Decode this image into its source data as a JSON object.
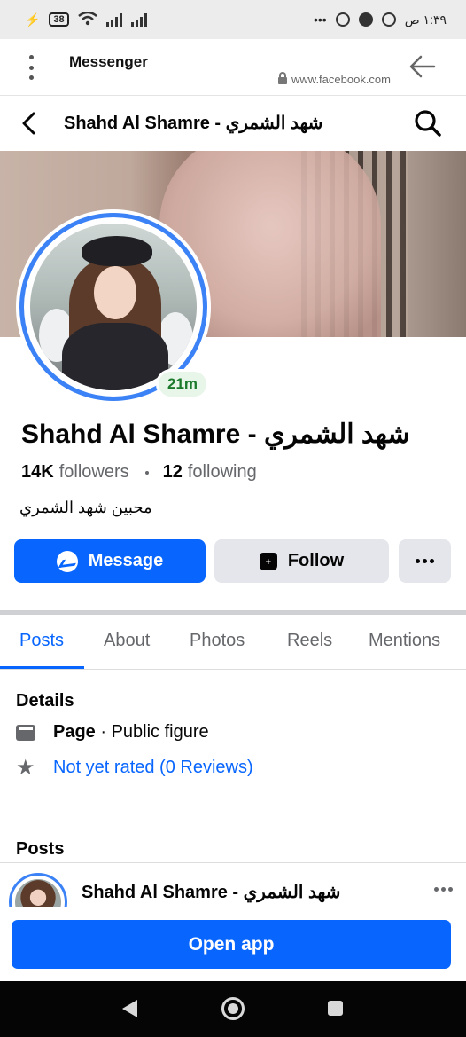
{
  "status_bar": {
    "battery": "38",
    "more": "•••",
    "time": "١:٣٩ ص"
  },
  "browser": {
    "title": "Messenger",
    "url": "www.facebook.com"
  },
  "header": {
    "title": "Shahd Al Shamre - شهد الشمري"
  },
  "profile": {
    "active_time": "21m",
    "name": "Shahd Al Shamre - شهد الشمري",
    "followers_count": "14K",
    "followers_label": "followers",
    "following_count": "12",
    "following_label": "following",
    "bio": "محبين شهد الشمري"
  },
  "actions": {
    "message": "Message",
    "follow": "Follow"
  },
  "tabs": [
    {
      "label": "Posts",
      "active": true
    },
    {
      "label": "About",
      "active": false
    },
    {
      "label": "Photos",
      "active": false
    },
    {
      "label": "Reels",
      "active": false
    },
    {
      "label": "Mentions",
      "active": false
    }
  ],
  "details": {
    "title": "Details",
    "category_bold": "Page",
    "category_rest": " · Public figure",
    "rating": "Not yet rated (0 Reviews)"
  },
  "posts": {
    "title": "Posts",
    "author": "Shahd Al Shamre - شهد الشمري"
  },
  "open_app": "Open app",
  "colors": {
    "accent": "#0866ff",
    "ring": "#3b82f6",
    "active_green": "#1b7a2b"
  }
}
